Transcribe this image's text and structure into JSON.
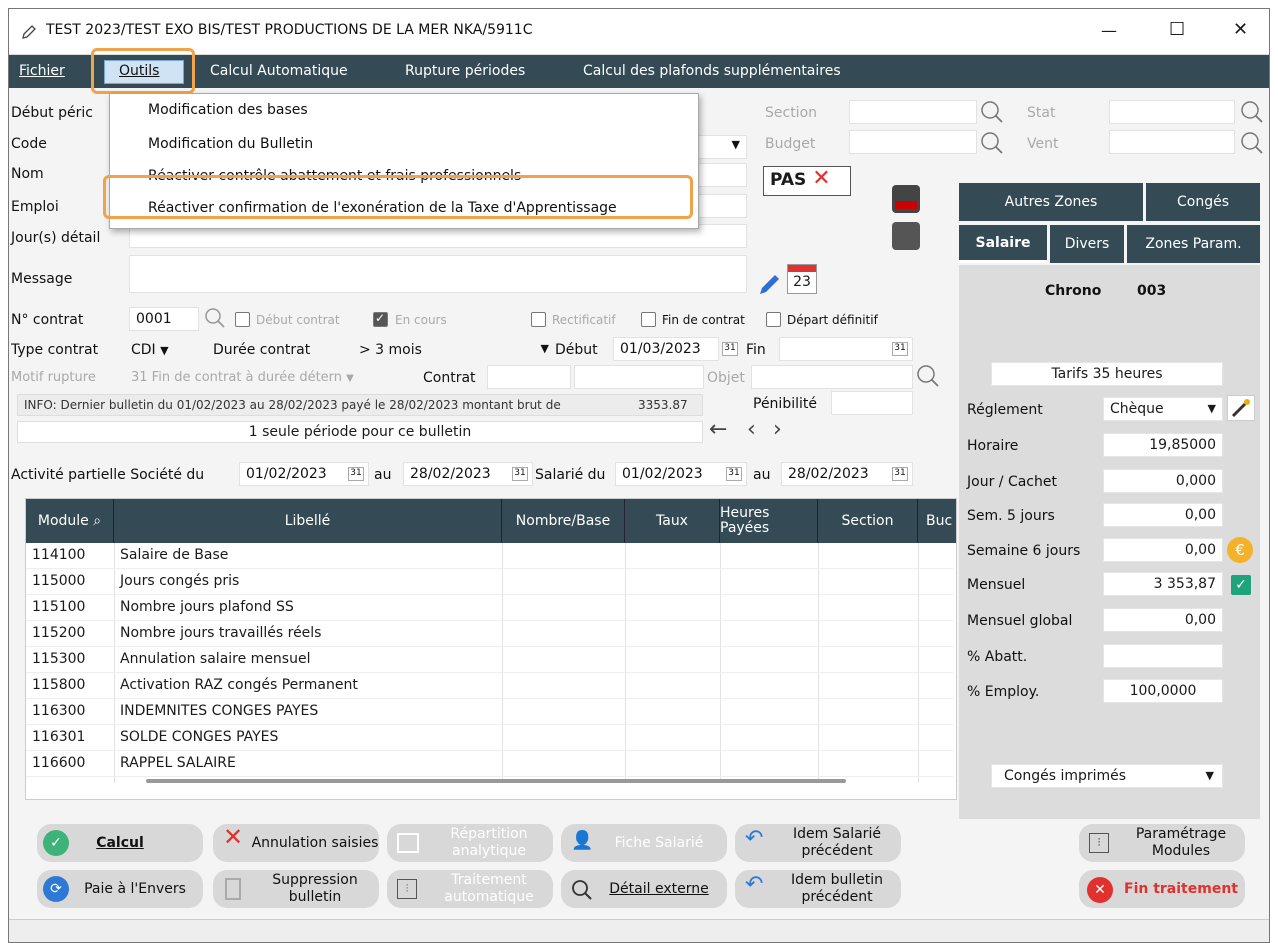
{
  "window": {
    "title": "TEST 2023/TEST EXO BIS/TEST PRODUCTIONS DE LA MER NKA/5911C",
    "minimize": "—",
    "maximize": "☐",
    "close": "✕"
  },
  "menubar": {
    "items": [
      "Fichier",
      "Outils",
      "Calcul Automatique",
      "Rupture périodes",
      "Calcul des plafonds supplémentaires"
    ]
  },
  "dropdown": {
    "items": [
      "Modification des bases",
      "Modification du Bulletin",
      "Réactiver contrôle abattement et frais professionnels",
      "Réactiver confirmation de l'exonération de la Taxe d'Apprentissage"
    ]
  },
  "form": {
    "debut_periode_label": "Début péric",
    "code_label": "Code",
    "nom_label": "Nom",
    "emploi_label": "Emploi",
    "jours_detail_label": "Jour(s) détail",
    "message_label": "Message",
    "section_label": "Section",
    "budget_label": "Budget",
    "stat_label": "Stat",
    "vent_label": "Vent",
    "pas_label": "PAS",
    "num_contrat_label": "N° contrat",
    "num_contrat_value": "0001",
    "debut_contrat_label": "Début contrat",
    "en_cours_label": "En cours",
    "rectificatif_label": "Rectificatif",
    "fin_contrat_label": "Fin de contrat",
    "depart_definitif_label": "Départ définitif",
    "type_contrat_label": "Type contrat",
    "type_contrat_value": "CDI",
    "duree_contrat_label": "Durée contrat",
    "duree_contrat_value": "> 3 mois",
    "debut_label": "Début",
    "debut_value": "01/03/2023",
    "fin_label": "Fin",
    "motif_rupture_label": "Motif rupture",
    "motif_rupture_value": "31 Fin de contrat à durée détern",
    "contrat_label": "Contrat",
    "objet_label": "Objet",
    "info_text": "INFO: Dernier bulletin du 01/02/2023 au 28/02/2023 payé le 28/02/2023 montant brut de",
    "info_amount": "3353.87",
    "penibilite_label": "Pénibilité",
    "periode_text": "1 seule période pour ce bulletin",
    "activite_label": "Activité partielle Société du",
    "act_du": "01/02/2023",
    "au_label": "au",
    "act_au": "28/02/2023",
    "salarie_du_label": "Salarié du",
    "sal_du": "01/02/2023",
    "sal_au": "28/02/2023",
    "cal_day": "31",
    "cal_big": "23"
  },
  "grid": {
    "headers": [
      "Module",
      "Libellé",
      "Nombre/Base",
      "Taux",
      "Heures Payées",
      "Section",
      "Buc"
    ],
    "rows": [
      {
        "module": "114100",
        "libelle": "Salaire de Base"
      },
      {
        "module": "115000",
        "libelle": "Jours congés pris"
      },
      {
        "module": "115100",
        "libelle": "Nombre jours plafond SS"
      },
      {
        "module": "115200",
        "libelle": "Nombre jours travaillés réels"
      },
      {
        "module": "115300",
        "libelle": "Annulation salaire mensuel"
      },
      {
        "module": "115800",
        "libelle": "Activation RAZ congés Permanent"
      },
      {
        "module": "116300",
        "libelle": "INDEMNITES CONGES PAYES"
      },
      {
        "module": "116301",
        "libelle": "SOLDE CONGES PAYES"
      },
      {
        "module": "116600",
        "libelle": "RAPPEL SALAIRE"
      }
    ]
  },
  "right_panel": {
    "tab_autres": "Autres Zones",
    "tab_conges": "Congés",
    "tab_salaire": "Salaire",
    "tab_divers": "Divers",
    "tab_zones": "Zones Param.",
    "chrono_label": "Chrono",
    "chrono_value": "003",
    "tarifs": "Tarifs 35 heures",
    "reglement_label": "Réglement",
    "reglement_value": "Chèque",
    "horaire_label": "Horaire",
    "horaire_value": "19,85000",
    "jour_cachet_label": "Jour / Cachet",
    "jour_cachet_value": "0,000",
    "sem5_label": "Sem. 5 jours",
    "sem5_value": "0,00",
    "sem6_label": "Semaine 6 jours",
    "sem6_value": "0,00",
    "mensuel_label": "Mensuel",
    "mensuel_value": "3 353,87",
    "mensuel_global_label": "Mensuel global",
    "mensuel_global_value": "0,00",
    "abatt_label": "% Abatt.",
    "employ_label": "% Employ.",
    "employ_value": "100,0000",
    "conges_imprimes": "Congés imprimés"
  },
  "buttons": {
    "calcul": "Calcul",
    "annulation": "Annulation saisies",
    "repartition": "Répartition analytique",
    "fiche": "Fiche Salarié",
    "idem_salarie": "Idem Salarié précédent",
    "parametrage": "Paramétrage Modules",
    "paie_envers": "Paie à l'Envers",
    "suppression": "Suppression bulletin",
    "traitement": "Traitement automatique",
    "detail_externe": "Détail externe",
    "idem_bulletin": "Idem bulletin précédent",
    "fin_traitement": "Fin traitement"
  },
  "colors": {
    "menubar": "#344a55",
    "highlight": "#f0a34a",
    "red": "#e0312f",
    "green": "#3db37a"
  }
}
